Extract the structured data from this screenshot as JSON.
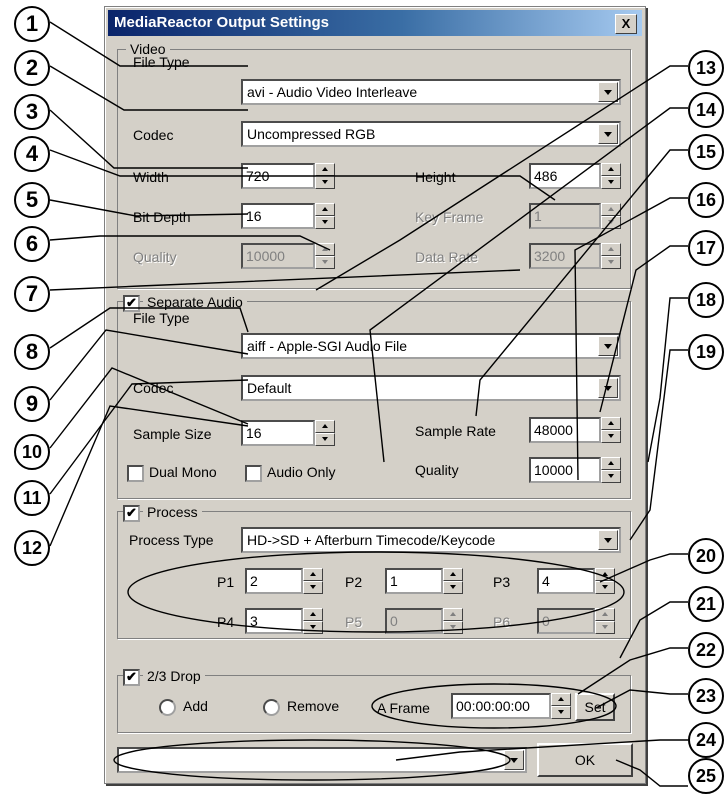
{
  "window": {
    "title": "MediaReactor Output Settings",
    "close_label": "X"
  },
  "video": {
    "group_label": "Video",
    "file_type_label": "File Type",
    "file_type_value": "avi - Audio Video Interleave",
    "codec_label": "Codec",
    "codec_value": "Uncompressed RGB",
    "width_label": "Width",
    "width_value": "720",
    "height_label": "Height",
    "height_value": "486",
    "bit_depth_label": "Bit Depth",
    "bit_depth_value": "16",
    "key_frame_label": "Key Frame",
    "key_frame_value": "1",
    "quality_label": "Quality",
    "quality_value": "10000",
    "data_rate_label": "Data Rate",
    "data_rate_value": "3200"
  },
  "audio": {
    "group_label": "Separate Audio",
    "checked": true,
    "file_type_label": "File Type",
    "file_type_value": "aiff - Apple-SGI Audio File",
    "codec_label": "Codec",
    "codec_value": "Default",
    "sample_size_label": "Sample Size",
    "sample_size_value": "16",
    "sample_rate_label": "Sample Rate",
    "sample_rate_value": "48000",
    "dual_mono_label": "Dual Mono",
    "audio_only_label": "Audio Only",
    "quality_label": "Quality",
    "quality_value": "10000"
  },
  "process": {
    "group_label": "Process",
    "checked": true,
    "type_label": "Process Type",
    "type_value": "HD->SD + Afterburn Timecode/Keycode",
    "p1_label": "P1",
    "p1_value": "2",
    "p2_label": "P2",
    "p2_value": "1",
    "p3_label": "P3",
    "p3_value": "4",
    "p4_label": "P4",
    "p4_value": "3",
    "p5_label": "P5",
    "p5_value": "0",
    "p6_label": "P6",
    "p6_value": "0"
  },
  "drop": {
    "group_label": "2/3 Drop",
    "checked": true,
    "add_label": "Add",
    "remove_label": "Remove",
    "aframe_label": "A Frame",
    "aframe_value": "00:00:00:00",
    "set_label": "Set"
  },
  "footer": {
    "preset_value": "",
    "ok_label": "OK"
  },
  "callouts": [
    "1",
    "2",
    "3",
    "4",
    "5",
    "6",
    "7",
    "8",
    "9",
    "10",
    "11",
    "12",
    "13",
    "14",
    "15",
    "16",
    "17",
    "18",
    "19",
    "20",
    "21",
    "22",
    "23",
    "24",
    "25"
  ],
  "check_mark": "✔"
}
